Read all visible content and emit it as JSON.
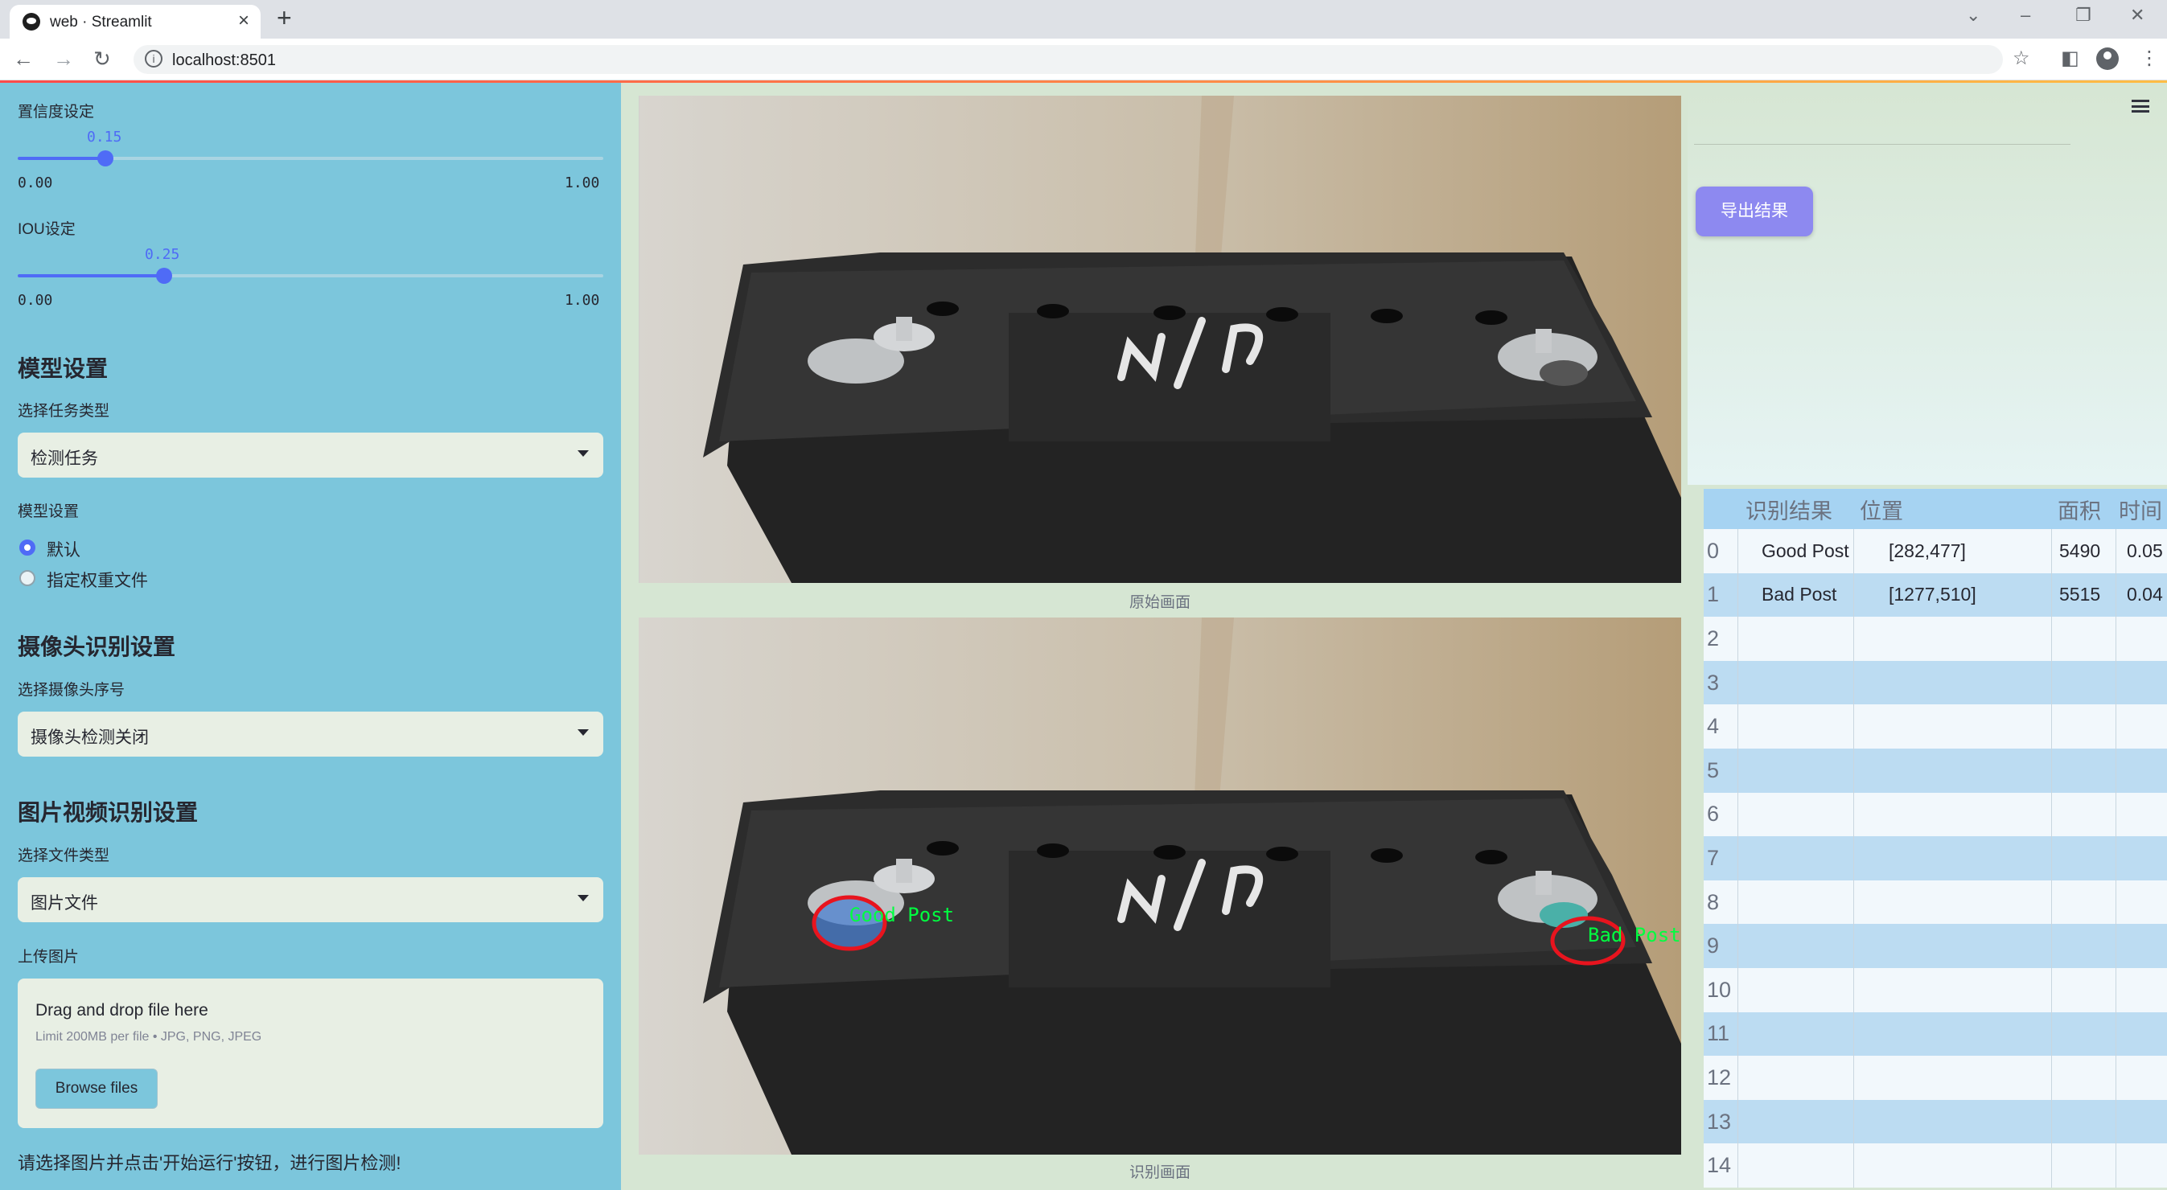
{
  "browser": {
    "tab_title": "web · Streamlit",
    "url": "localhost:8501"
  },
  "sidebar": {
    "confidence": {
      "label": "置信度设定",
      "value": "0.15",
      "min": "0.00",
      "max": "1.00",
      "fraction": 0.15
    },
    "iou": {
      "label": "IOU设定",
      "value": "0.25",
      "min": "0.00",
      "max": "1.00",
      "fraction": 0.25
    },
    "model_section": "模型设置",
    "task_type_label": "选择任务类型",
    "task_type_value": "检测任务",
    "model_label": "模型设置",
    "model_options": [
      "默认",
      "指定权重文件"
    ],
    "model_selected_index": 0,
    "camera_section": "摄像头识别设置",
    "camera_label": "选择摄像头序号",
    "camera_value": "摄像头检测关闭",
    "media_section": "图片视频识别设置",
    "file_type_label": "选择文件类型",
    "file_type_value": "图片文件",
    "upload_label": "上传图片",
    "upload_drag": "Drag and drop file here",
    "upload_limit": "Limit 200MB per file • JPG, PNG, JPEG",
    "browse_button": "Browse files",
    "hint": "请选择图片并点击'开始运行'按钮，进行图片检测!"
  },
  "main": {
    "original_caption": "原始画面",
    "result_caption": "识别画面",
    "export_button": "导出结果",
    "detections": [
      {
        "label": "Good Post",
        "color": "#00ff40"
      },
      {
        "label": "Bad Post",
        "color": "#00ff40"
      }
    ],
    "battery_marking": "N/P"
  },
  "table": {
    "headers": [
      "",
      "识别结果",
      "位置",
      "面积",
      "时间"
    ],
    "rows": [
      {
        "idx": "0",
        "result": "Good Post",
        "pos": "[282,477]",
        "area": "5490",
        "time": "0.05"
      },
      {
        "idx": "1",
        "result": "Bad Post",
        "pos": "[1277,510]",
        "area": "5515",
        "time": "0.04"
      },
      {
        "idx": "2",
        "result": "",
        "pos": "",
        "area": "",
        "time": ""
      },
      {
        "idx": "3",
        "result": "",
        "pos": "",
        "area": "",
        "time": ""
      },
      {
        "idx": "4",
        "result": "",
        "pos": "",
        "area": "",
        "time": ""
      },
      {
        "idx": "5",
        "result": "",
        "pos": "",
        "area": "",
        "time": ""
      },
      {
        "idx": "6",
        "result": "",
        "pos": "",
        "area": "",
        "time": ""
      },
      {
        "idx": "7",
        "result": "",
        "pos": "",
        "area": "",
        "time": ""
      },
      {
        "idx": "8",
        "result": "",
        "pos": "",
        "area": "",
        "time": ""
      },
      {
        "idx": "9",
        "result": "",
        "pos": "",
        "area": "",
        "time": ""
      },
      {
        "idx": "10",
        "result": "",
        "pos": "",
        "area": "",
        "time": ""
      },
      {
        "idx": "11",
        "result": "",
        "pos": "",
        "area": "",
        "time": ""
      },
      {
        "idx": "12",
        "result": "",
        "pos": "",
        "area": "",
        "time": ""
      },
      {
        "idx": "13",
        "result": "",
        "pos": "",
        "area": "",
        "time": ""
      },
      {
        "idx": "14",
        "result": "",
        "pos": "",
        "area": "",
        "time": ""
      }
    ]
  },
  "icons": [
    "favicon-icon",
    "close-icon",
    "plus-icon",
    "back-icon",
    "forward-icon",
    "reload-icon",
    "info-icon",
    "star-icon",
    "sidepanel-icon",
    "profile-icon",
    "menu-icon",
    "hamburger-icon"
  ],
  "colors": {
    "sidebar": "#7cc6dc",
    "main": "#d6e6d3",
    "accent": "#4f6bf6",
    "export": "#8d89f0",
    "detect_box": "#e8141e"
  }
}
